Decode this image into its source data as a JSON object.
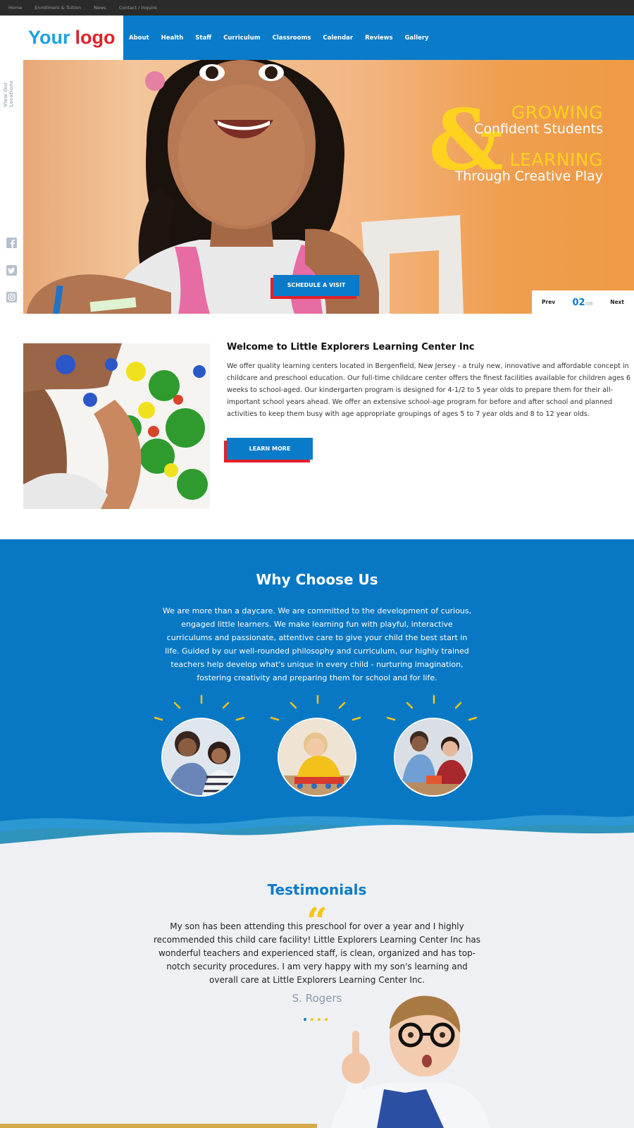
{
  "utility_nav": [
    "Home",
    "Enrollment & Tuition",
    "News",
    "Contact / Inquire"
  ],
  "logo": {
    "part1": "Your",
    "part2": "logo"
  },
  "main_nav": [
    "About",
    "Health",
    "Staff",
    "Curriculum",
    "Classrooms",
    "Calendar",
    "Reviews",
    "Gallery"
  ],
  "sidebar": {
    "locations_line1": "View Our",
    "locations_line2": "Locations",
    "social_icons": [
      "facebook-icon",
      "twitter-icon",
      "instagram-icon"
    ]
  },
  "hero": {
    "line1": "GROWING",
    "line2": "Confident Students",
    "ampersand": "&",
    "line3": "LEARNING",
    "line4": "Through Creative Play",
    "cta": "SCHEDULE A VISIT",
    "slider": {
      "prev": "Prev",
      "current": "02",
      "total": "/06",
      "next": "Next"
    }
  },
  "welcome": {
    "title": "Welcome to Little Explorers Learning Center Inc",
    "body": "We offer quality learning centers located in Bergenfield, New Jersey - a truly new, innovative and affordable concept in childcare and preschool education. Our full-time childcare center offers the finest facilities available for children ages 6 weeks to school-aged. Our kindergarten program is designed for 4-1/2 to 5 year olds to prepare them for their all-important school years ahead. We offer an extensive school-age program for before and after school and planned activities to keep them busy with age appropriate groupings of ages 5 to 7 year olds and 8 to 12 year olds.",
    "cta": "LEARN MORE"
  },
  "why": {
    "title": "Why Choose Us",
    "body": "We are more than a daycare. We are committed to the development of curious, engaged little learners. We make learning fun with playful, interactive curriculums and passionate, attentive care to give your child the best start in life. Guided by our well-rounded philosophy and curriculum, our highly trained teachers help develop what's unique in every child - nurturing imagination, fostering creativity and preparing them for school and for life."
  },
  "testimonials": {
    "title": "Testimonials",
    "quote_mark": "“",
    "quote": "My son has been attending this preschool for over a year and I highly recommended this child care facility! Little Explorers Learning Center Inc has wonderful teachers and experienced staff, is clean, organized and has top-notch security procedures. I am very happy with my son's learning and overall care at Little Explorers Learning Center Inc.",
    "author": "S. Rogers",
    "dots_total": 4,
    "dots_active_index": 0
  },
  "colors": {
    "brand_blue": "#0a7bc8",
    "brand_red": "#e3202b",
    "accent_yellow": "#ffd21f",
    "hero_orange": "#ef9a44"
  }
}
